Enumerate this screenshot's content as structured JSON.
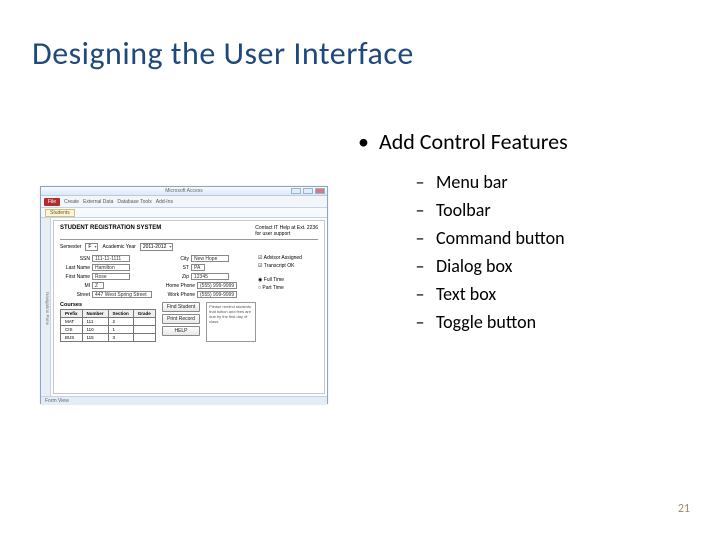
{
  "title": "Designing the User Interface",
  "bullet": "Add Control Features",
  "items": [
    "Menu bar",
    "Toolbar",
    "Command button",
    "Dialog box",
    "Text box",
    "Toggle button"
  ],
  "page_number": "21",
  "screenshot": {
    "app_title": "Microsoft Access",
    "file_tab": "File",
    "ribbon_tabs": [
      "Create",
      "External Data",
      "Database Tools",
      "Add-Ins"
    ],
    "doc_tab": "Students",
    "nav_pane": "Navigation Pane",
    "form_title": "STUDENT REGISTRATION SYSTEM",
    "help_line1": "Contact IT Help at Ext. 2236",
    "help_line2": "for user support",
    "sem_label": "Semester",
    "sem_value": "F",
    "year_label": "Academic Year",
    "year_value": "2011-2012",
    "left_fields": [
      {
        "label": "SSN",
        "value": "111-11-1111"
      },
      {
        "label": "Last Name",
        "value": "Hamilton"
      },
      {
        "label": "First Name",
        "value": "Rose"
      },
      {
        "label": "MI",
        "value": "Z"
      },
      {
        "label": "Street",
        "value": "447 West Spring Street"
      }
    ],
    "right_fields": [
      {
        "label": "City",
        "value": "New Hope"
      },
      {
        "label": "ST",
        "value": "PA"
      },
      {
        "label": "Zip",
        "value": "12345"
      },
      {
        "label": "Home Phone",
        "value": "(555) 999-9999"
      },
      {
        "label": "Work Phone",
        "value": "(555) 999-9999"
      }
    ],
    "checks": {
      "advisor": "Advisor Assigned",
      "transcript": "Transcript OK",
      "fulltime": "Full Time",
      "parttime": "Part Time"
    },
    "courses_label": "Courses",
    "courses_headers": [
      "Prefix",
      "Number",
      "Section",
      "Grade"
    ],
    "courses_rows": [
      [
        "MAT",
        "111",
        "2",
        ""
      ],
      [
        "CIS",
        "110",
        "1",
        ""
      ],
      [
        "BUS",
        "115",
        "3",
        ""
      ]
    ],
    "buttons": [
      "Find Student",
      "Print Record",
      "HELP"
    ],
    "note": "Please remind students that tuition and fees are due by the first day of class.",
    "status": "Form View"
  }
}
